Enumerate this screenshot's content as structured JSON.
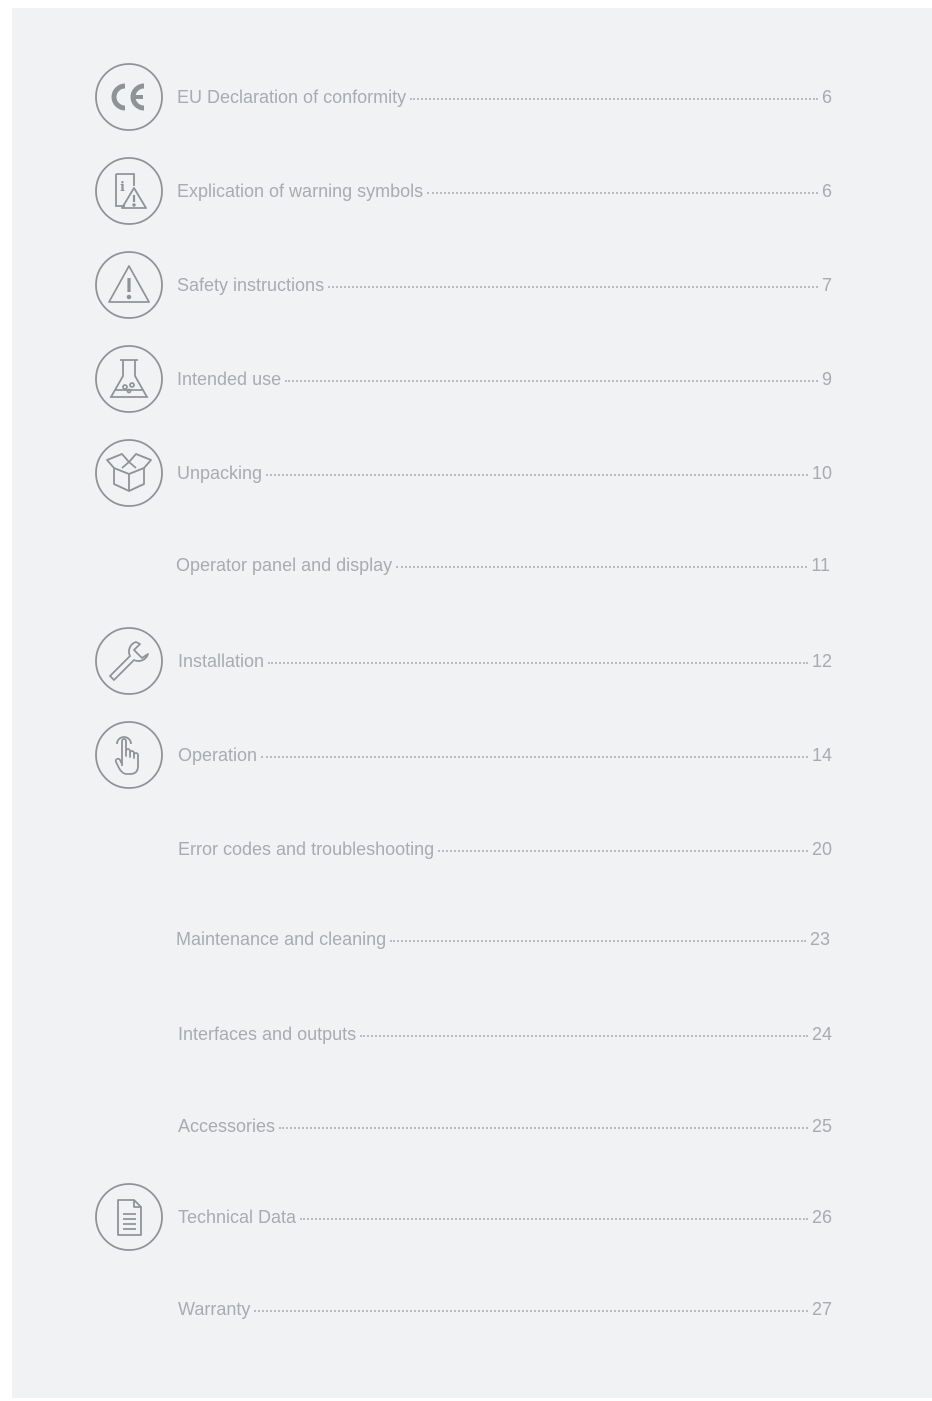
{
  "toc": [
    {
      "title": "EU Declaration of conformity",
      "page": "6",
      "icon": "ce-mark-icon"
    },
    {
      "title": "Explication of warning symbols",
      "page": "6",
      "icon": "info-warning-icon"
    },
    {
      "title": "Safety instructions",
      "page": "7",
      "icon": "warning-triangle-icon"
    },
    {
      "title": "Intended use",
      "page": "9",
      "icon": "lab-flask-icon"
    },
    {
      "title": "Unpacking",
      "page": "10",
      "icon": "open-box-icon"
    },
    {
      "title": "Operator panel and display",
      "page": "11",
      "icon": null
    },
    {
      "title": "Installation",
      "page": "12",
      "icon": "wrench-icon"
    },
    {
      "title": "Operation",
      "page": "14",
      "icon": "touch-hand-icon"
    },
    {
      "title": "Error codes and troubleshooting",
      "page": "20",
      "icon": null
    },
    {
      "title": "Maintenance and cleaning",
      "page": "23",
      "icon": null
    },
    {
      "title": "Interfaces and outputs",
      "page": "24",
      "icon": null
    },
    {
      "title": "Accessories",
      "page": "25",
      "icon": null
    },
    {
      "title": "Technical Data",
      "page": "26",
      "icon": "document-icon"
    },
    {
      "title": "Warranty",
      "page": "27",
      "icon": null
    }
  ],
  "colors": {
    "background": "#f1f2f4",
    "text": "#a8abb0",
    "icon_stroke": "#8f9398"
  }
}
